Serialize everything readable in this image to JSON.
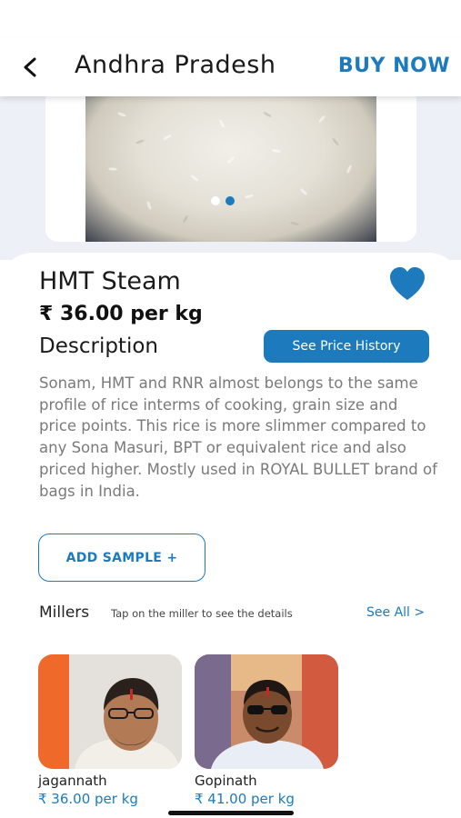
{
  "header": {
    "back_icon": "back-arrow-icon",
    "title": "Andhra Pradesh",
    "buy_now": "BUY NOW"
  },
  "gallery": {
    "image": "rice-grains",
    "dots": 2,
    "active_dot": 1
  },
  "product": {
    "name": "HMT Steam",
    "price": "₹ 36.00 per kg",
    "favorite_icon": "heart-icon",
    "favorite": true
  },
  "description": {
    "title": "Description",
    "price_history_button": "See Price History",
    "text": "Sonam, HMT and RNR almost belongs to the same profile of rice interms of cooking, grain size and price points. This rice is more slimmer compared to any Sona Masuri, BPT or equivalent rice and also priced higher. Mostly used in ROYAL BULLET brand of bags in India."
  },
  "actions": {
    "add_sample": "ADD SAMPLE +"
  },
  "millers": {
    "title": "Millers",
    "hint": "Tap on the miller to see the details",
    "see_all": "See All >",
    "items": [
      {
        "name": "jagannath",
        "price": "₹ 36.00 per kg"
      },
      {
        "name": "Gopinath",
        "price": "₹ 41.00 per kg"
      }
    ]
  },
  "colors": {
    "accent": "#1d7bbd",
    "text": "#1a1a1a",
    "muted": "#7a7a7a"
  }
}
